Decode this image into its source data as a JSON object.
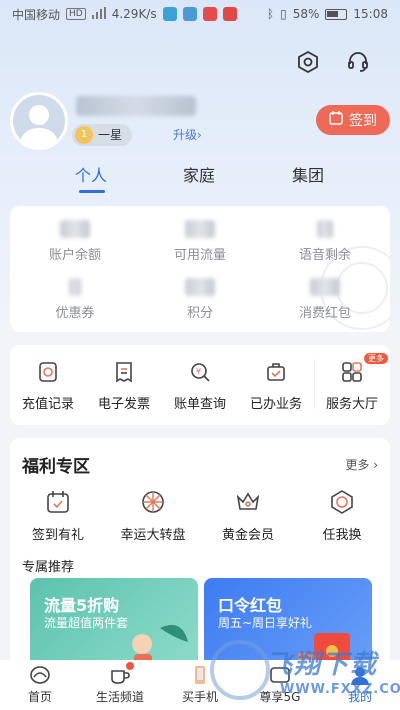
{
  "status_bar": {
    "carrier": "中国移动",
    "network_type": "HD",
    "speed": "4.29K/s",
    "battery": "58%",
    "time": "15:08"
  },
  "profile": {
    "level": "一星",
    "upgrade": "升级",
    "checkin": "签到"
  },
  "tabs": [
    "个人",
    "家庭",
    "集团"
  ],
  "account": {
    "items": [
      {
        "label": "账户余额"
      },
      {
        "label": "可用流量"
      },
      {
        "label": "语音剩余"
      },
      {
        "label": "优惠券"
      },
      {
        "label": "积分"
      },
      {
        "label": "消费红包"
      }
    ]
  },
  "services": {
    "items": [
      {
        "label": "充值记录",
        "icon": "recharge-record-icon"
      },
      {
        "label": "电子发票",
        "icon": "invoice-icon"
      },
      {
        "label": "账单查询",
        "icon": "bill-query-icon"
      },
      {
        "label": "已办业务",
        "icon": "handled-business-icon"
      },
      {
        "label": "服务大厅",
        "icon": "service-hall-icon",
        "badge": "更多"
      }
    ]
  },
  "welfare": {
    "title": "福利专区",
    "more": "更多",
    "items": [
      {
        "label": "签到有礼",
        "icon": "calendar-gift-icon"
      },
      {
        "label": "幸运大转盘",
        "icon": "wheel-icon"
      },
      {
        "label": "黄金会员",
        "icon": "crown-icon"
      },
      {
        "label": "任我换",
        "icon": "exchange-icon"
      }
    ],
    "recommend_title": "专属推荐",
    "banners": [
      {
        "title": "流量5折购",
        "subtitle": "流量超值两件套"
      },
      {
        "title": "口令红包",
        "subtitle": "周五~周日享好礼"
      }
    ]
  },
  "bottom_nav": [
    {
      "label": "首页",
      "icon": "home-logo-icon"
    },
    {
      "label": "生活频道",
      "icon": "life-channel-icon"
    },
    {
      "label": "买手机",
      "icon": "phone-icon"
    },
    {
      "label": "尊享5G",
      "icon": "5g-icon"
    },
    {
      "label": "我的",
      "icon": "profile-icon"
    }
  ],
  "watermark": {
    "text": "飞翔下载",
    "url": "WWW.FXXZ.COM"
  },
  "colors": {
    "accent": "#2f6fd9",
    "checkin": "#ee6a57"
  }
}
